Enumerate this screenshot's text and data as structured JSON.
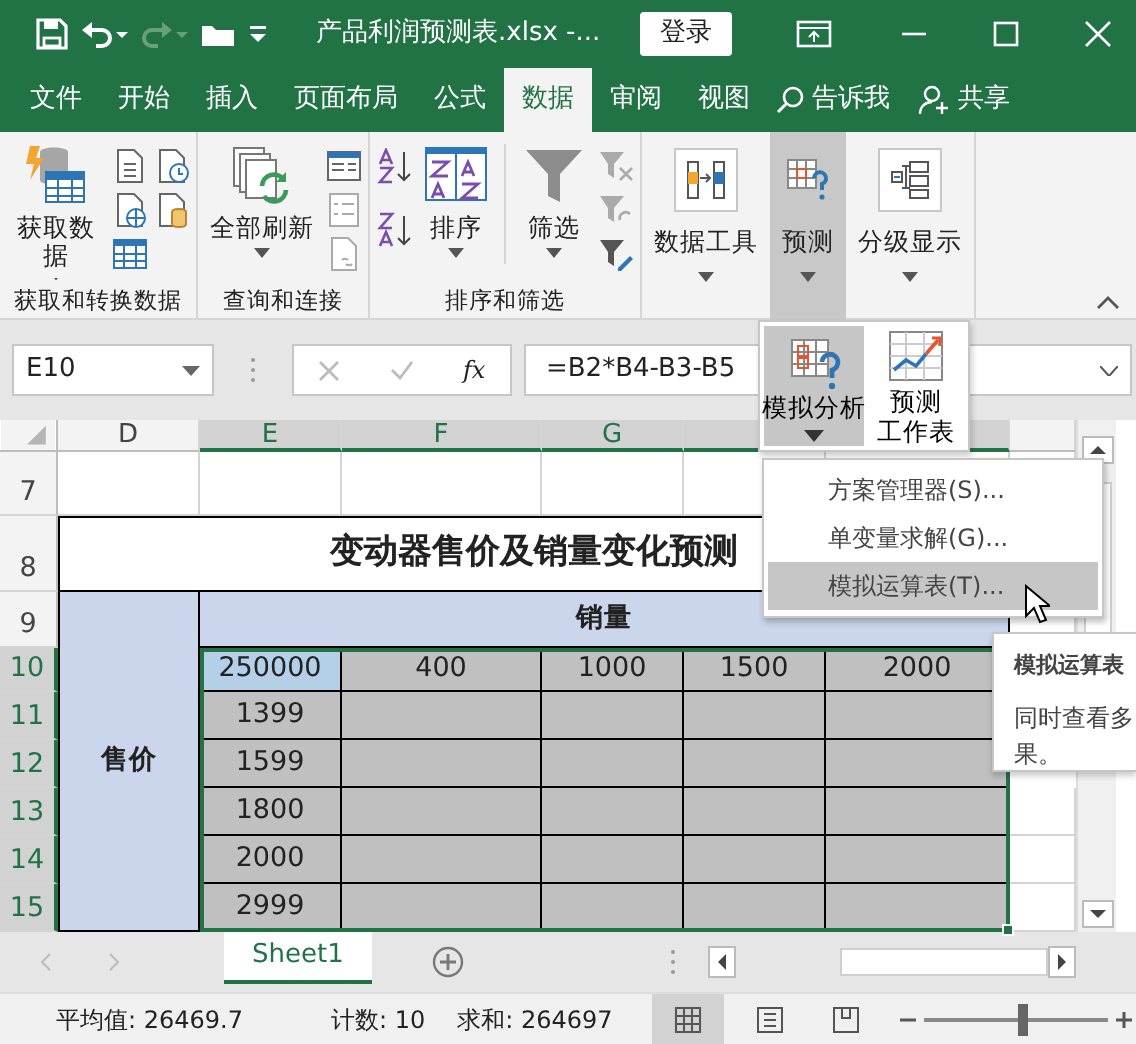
{
  "title_bar": {
    "file_name": "产品利润预测表.xlsx  -...",
    "sign_in_button": "登录"
  },
  "menu_tabs": [
    {
      "label": "文件",
      "selected": false
    },
    {
      "label": "开始",
      "selected": false
    },
    {
      "label": "插入",
      "selected": false
    },
    {
      "label": "页面布局",
      "selected": false
    },
    {
      "label": "公式",
      "selected": false
    },
    {
      "label": "数据",
      "selected": true
    },
    {
      "label": "审阅",
      "selected": false
    },
    {
      "label": "视图",
      "selected": false
    }
  ],
  "tell_me": "告诉我",
  "share": "共享",
  "ribbon": {
    "groups": [
      {
        "label": "获取和转换数据",
        "buttons": [
          {
            "label": "获取数据",
            "pressed": false
          }
        ]
      },
      {
        "label": "查询和连接",
        "buttons": [
          {
            "label": "全部刷新",
            "pressed": false
          }
        ]
      },
      {
        "label": "排序和筛选",
        "buttons": [
          {
            "label": "排序",
            "pressed": false
          },
          {
            "label": "筛选",
            "pressed": false
          }
        ]
      },
      {
        "buttons": [
          {
            "label": "数据工具",
            "pressed": false
          },
          {
            "label": "预测",
            "pressed": true
          },
          {
            "label": "分级显示",
            "pressed": false
          }
        ]
      }
    ]
  },
  "formula_bar": {
    "name_box": "E10",
    "function_button": "fx",
    "formula": "=B2*B4-B3-B5"
  },
  "forecast_panel": {
    "items": [
      {
        "lines": [
          "模拟分析"
        ],
        "selected": true,
        "dropdown": true
      },
      {
        "lines": [
          "预测",
          "工作表"
        ],
        "selected": false,
        "dropdown": false
      }
    ]
  },
  "what_if_menu": {
    "items": [
      {
        "label": "方案管理器(S)...",
        "selected": false
      },
      {
        "label": "单变量求解(G)...",
        "selected": false
      },
      {
        "label": "模拟运算表(T)...",
        "selected": true
      }
    ]
  },
  "tooltip": {
    "title": "模拟运算表",
    "lines": [
      "同时查看多",
      "果。"
    ]
  },
  "sheet": {
    "column_headers": [
      {
        "label": "D",
        "selected": false
      },
      {
        "label": "E",
        "selected": true
      },
      {
        "label": "F",
        "selected": true
      },
      {
        "label": "G",
        "selected": true
      }
    ],
    "row_headers": [
      {
        "label": "7",
        "selected": false
      },
      {
        "label": "8",
        "selected": false
      },
      {
        "label": "9",
        "selected": false
      },
      {
        "label": "10",
        "selected": true
      },
      {
        "label": "11",
        "selected": true
      },
      {
        "label": "12",
        "selected": true
      },
      {
        "label": "13",
        "selected": true
      },
      {
        "label": "14",
        "selected": true
      },
      {
        "label": "15",
        "selected": true
      }
    ],
    "title": "变动器售价及销量变化预测",
    "row_label": "售价",
    "column_label": "销量",
    "header_row": [
      {
        "value": "250000",
        "active": true
      },
      {
        "value": "400",
        "active": false
      },
      {
        "value": "1000",
        "active": false
      },
      {
        "value": "1500",
        "active": false
      },
      {
        "value": "2000",
        "active": false
      }
    ],
    "input_values": [
      "1399",
      "1599",
      "1800",
      "2000",
      "2999"
    ]
  },
  "sheet_tabs": [
    {
      "label": "Sheet1",
      "selected": true
    }
  ],
  "status_bar": {
    "average": "平均值: 26469.7",
    "count": "计数: 10",
    "sum": "求和: 264697",
    "zoom": {
      "level": 0.53
    }
  }
}
